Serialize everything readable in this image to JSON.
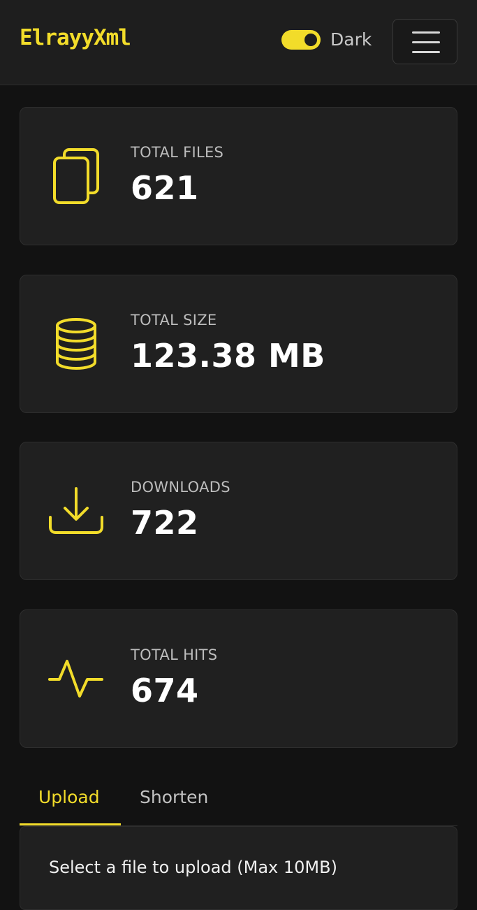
{
  "navbar": {
    "brand": "ElrayyXml",
    "theme_toggle": {
      "label": "Dark",
      "on": true
    },
    "menu_icon": "hamburger-menu-icon"
  },
  "stats": [
    {
      "icon": "files-icon",
      "label": "TOTAL FILES",
      "value": "621"
    },
    {
      "icon": "database-icon",
      "label": "TOTAL SIZE",
      "value": "123.38 MB"
    },
    {
      "icon": "download-icon",
      "label": "DOWNLOADS",
      "value": "722"
    },
    {
      "icon": "activity-icon",
      "label": "TOTAL HITS",
      "value": "674"
    }
  ],
  "tabs": [
    {
      "label": "Upload",
      "active": true
    },
    {
      "label": "Shorten",
      "active": false
    }
  ],
  "upload": {
    "select_label": "Select a file to upload (Max 10MB)"
  },
  "colors": {
    "accent": "#f2dc2a",
    "background": "#121212",
    "card": "#202020"
  }
}
